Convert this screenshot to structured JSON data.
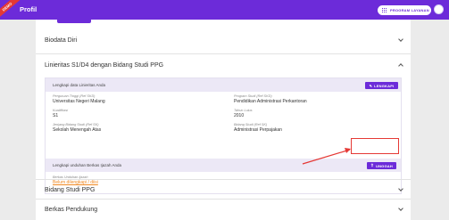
{
  "header": {
    "ribbon": "DEMO",
    "title": "Profil",
    "layanan_label": "PROGRAM LAYANAN"
  },
  "sections": {
    "biodata": "Biodata Diri",
    "linieritas": "Linieritas S1/D4 dengan Bidang Studi PPG",
    "bidang_studi": "Bidang Studi PPG",
    "berkas": "Berkas Pendukung"
  },
  "linieritas_panel": {
    "head": "Lengkapi data Linieritas Anda",
    "lengkapi_label": "LENGKAPI",
    "fields": [
      {
        "key": "Perguruan Tinggi (Ref SKD)",
        "value": "Universitas Negeri Malang"
      },
      {
        "key": "Program Studi (Ref SKD)",
        "value": "Pendidikan Administrasi Perkantoran"
      },
      {
        "key": "Kualifikasi",
        "value": "S1"
      },
      {
        "key": "Tahun Lulus",
        "value": "2010"
      },
      {
        "key": "Jenjang Bidang Studi (Ref SK)",
        "value": "Sekolah Menengah Atas"
      },
      {
        "key": "Bidang Studi (Ref SK)",
        "value": "Administrasi Perpajakan"
      }
    ]
  },
  "ijazah_panel": {
    "head": "Lengkapi unduhan Berkas Ijazah Anda",
    "unggah_label": "UNGGAH",
    "field_key": "Berkas Unduhan Ijazah",
    "field_value": "Belum dilengkapi / diisi"
  },
  "colors": {
    "brand": "#6c2bd9",
    "highlight": "#e53935",
    "warning": "#f08a24"
  }
}
